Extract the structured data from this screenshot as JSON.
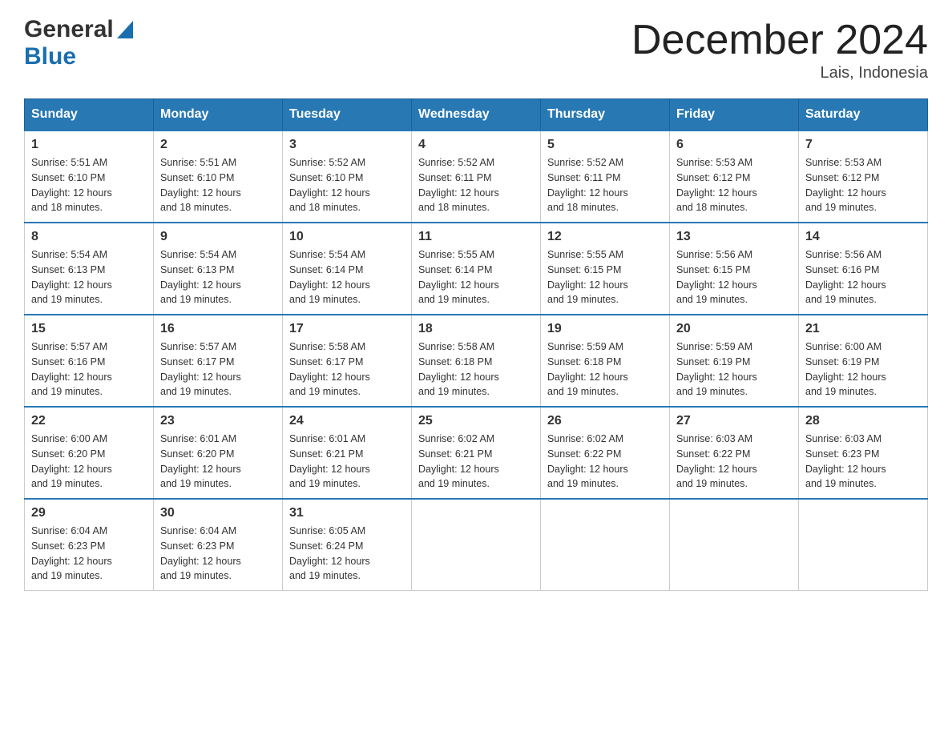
{
  "header": {
    "logo": {
      "general": "General",
      "blue": "Blue",
      "triangle": "▲"
    },
    "title": "December 2024",
    "location": "Lais, Indonesia"
  },
  "weekdays": [
    "Sunday",
    "Monday",
    "Tuesday",
    "Wednesday",
    "Thursday",
    "Friday",
    "Saturday"
  ],
  "weeks": [
    [
      {
        "day": "1",
        "sunrise": "5:51 AM",
        "sunset": "6:10 PM",
        "daylight": "12 hours and 18 minutes."
      },
      {
        "day": "2",
        "sunrise": "5:51 AM",
        "sunset": "6:10 PM",
        "daylight": "12 hours and 18 minutes."
      },
      {
        "day": "3",
        "sunrise": "5:52 AM",
        "sunset": "6:10 PM",
        "daylight": "12 hours and 18 minutes."
      },
      {
        "day": "4",
        "sunrise": "5:52 AM",
        "sunset": "6:11 PM",
        "daylight": "12 hours and 18 minutes."
      },
      {
        "day": "5",
        "sunrise": "5:52 AM",
        "sunset": "6:11 PM",
        "daylight": "12 hours and 18 minutes."
      },
      {
        "day": "6",
        "sunrise": "5:53 AM",
        "sunset": "6:12 PM",
        "daylight": "12 hours and 18 minutes."
      },
      {
        "day": "7",
        "sunrise": "5:53 AM",
        "sunset": "6:12 PM",
        "daylight": "12 hours and 19 minutes."
      }
    ],
    [
      {
        "day": "8",
        "sunrise": "5:54 AM",
        "sunset": "6:13 PM",
        "daylight": "12 hours and 19 minutes."
      },
      {
        "day": "9",
        "sunrise": "5:54 AM",
        "sunset": "6:13 PM",
        "daylight": "12 hours and 19 minutes."
      },
      {
        "day": "10",
        "sunrise": "5:54 AM",
        "sunset": "6:14 PM",
        "daylight": "12 hours and 19 minutes."
      },
      {
        "day": "11",
        "sunrise": "5:55 AM",
        "sunset": "6:14 PM",
        "daylight": "12 hours and 19 minutes."
      },
      {
        "day": "12",
        "sunrise": "5:55 AM",
        "sunset": "6:15 PM",
        "daylight": "12 hours and 19 minutes."
      },
      {
        "day": "13",
        "sunrise": "5:56 AM",
        "sunset": "6:15 PM",
        "daylight": "12 hours and 19 minutes."
      },
      {
        "day": "14",
        "sunrise": "5:56 AM",
        "sunset": "6:16 PM",
        "daylight": "12 hours and 19 minutes."
      }
    ],
    [
      {
        "day": "15",
        "sunrise": "5:57 AM",
        "sunset": "6:16 PM",
        "daylight": "12 hours and 19 minutes."
      },
      {
        "day": "16",
        "sunrise": "5:57 AM",
        "sunset": "6:17 PM",
        "daylight": "12 hours and 19 minutes."
      },
      {
        "day": "17",
        "sunrise": "5:58 AM",
        "sunset": "6:17 PM",
        "daylight": "12 hours and 19 minutes."
      },
      {
        "day": "18",
        "sunrise": "5:58 AM",
        "sunset": "6:18 PM",
        "daylight": "12 hours and 19 minutes."
      },
      {
        "day": "19",
        "sunrise": "5:59 AM",
        "sunset": "6:18 PM",
        "daylight": "12 hours and 19 minutes."
      },
      {
        "day": "20",
        "sunrise": "5:59 AM",
        "sunset": "6:19 PM",
        "daylight": "12 hours and 19 minutes."
      },
      {
        "day": "21",
        "sunrise": "6:00 AM",
        "sunset": "6:19 PM",
        "daylight": "12 hours and 19 minutes."
      }
    ],
    [
      {
        "day": "22",
        "sunrise": "6:00 AM",
        "sunset": "6:20 PM",
        "daylight": "12 hours and 19 minutes."
      },
      {
        "day": "23",
        "sunrise": "6:01 AM",
        "sunset": "6:20 PM",
        "daylight": "12 hours and 19 minutes."
      },
      {
        "day": "24",
        "sunrise": "6:01 AM",
        "sunset": "6:21 PM",
        "daylight": "12 hours and 19 minutes."
      },
      {
        "day": "25",
        "sunrise": "6:02 AM",
        "sunset": "6:21 PM",
        "daylight": "12 hours and 19 minutes."
      },
      {
        "day": "26",
        "sunrise": "6:02 AM",
        "sunset": "6:22 PM",
        "daylight": "12 hours and 19 minutes."
      },
      {
        "day": "27",
        "sunrise": "6:03 AM",
        "sunset": "6:22 PM",
        "daylight": "12 hours and 19 minutes."
      },
      {
        "day": "28",
        "sunrise": "6:03 AM",
        "sunset": "6:23 PM",
        "daylight": "12 hours and 19 minutes."
      }
    ],
    [
      {
        "day": "29",
        "sunrise": "6:04 AM",
        "sunset": "6:23 PM",
        "daylight": "12 hours and 19 minutes."
      },
      {
        "day": "30",
        "sunrise": "6:04 AM",
        "sunset": "6:23 PM",
        "daylight": "12 hours and 19 minutes."
      },
      {
        "day": "31",
        "sunrise": "6:05 AM",
        "sunset": "6:24 PM",
        "daylight": "12 hours and 19 minutes."
      },
      null,
      null,
      null,
      null
    ]
  ],
  "labels": {
    "sunrise_prefix": "Sunrise: ",
    "sunset_prefix": "Sunset: ",
    "daylight_prefix": "Daylight: "
  }
}
